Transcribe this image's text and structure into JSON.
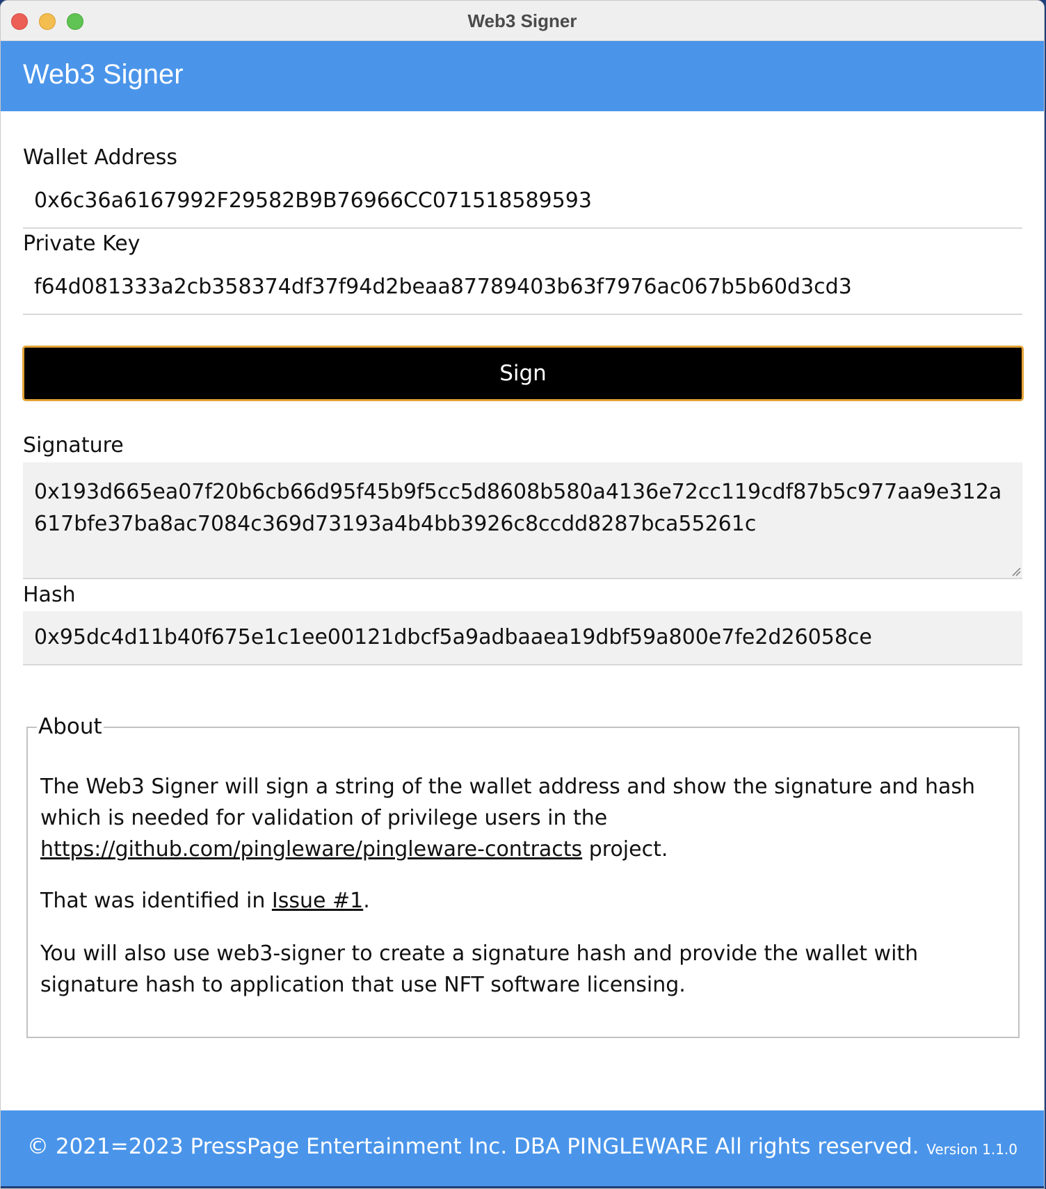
{
  "window": {
    "title": "Web3 Signer"
  },
  "header": {
    "title": "Web3 Signer",
    "color": "#4a95ea"
  },
  "form": {
    "wallet_label": "Wallet Address",
    "wallet_value": "0x6c36a6167992F29582B9B76966CC071518589593",
    "private_key_label": "Private Key",
    "private_key_value": "f64d081333a2cb358374df37f94d2beaa87789403b63f7976ac067b5b60d3cd3",
    "sign_label": "Sign",
    "signature_label": "Signature",
    "signature_value": "0x193d665ea07f20b6cb66d95f45b9f5cc5d8608b580a4136e72cc119cdf87b5c977aa9e312a617bfe37ba8ac7084c369d73193a4b4bb3926c8ccdd8287bca55261c",
    "hash_label": "Hash",
    "hash_value": "0x95dc4d11b40f675e1c1ee00121dbcf5a9adbaaea19dbf59a800e7fe2d26058ce"
  },
  "about": {
    "legend": "About",
    "p1_text": "The Web3 Signer will sign a string of the wallet address and show the signature and hash which is needed for validation of privilege users in the",
    "p1_link": "https://github.com/pingleware/pingleware-contracts",
    "p1_suffix": " project.",
    "p2_prefix": "That was identified in ",
    "p2_link": "Issue #1",
    "p2_suffix": ".",
    "p3_text": "You will also use web3-signer to create a signature hash and provide the wallet with signature hash to application that use NFT software licensing."
  },
  "footer": {
    "copyright": "© 2021=2023 PressPage Entertainment Inc. DBA PINGLEWARE  All rights reserved.",
    "version": "Version 1.1.0"
  },
  "colors": {
    "accent": "#4a95ea",
    "button_bg": "#000000",
    "button_border": "#e3a236"
  }
}
